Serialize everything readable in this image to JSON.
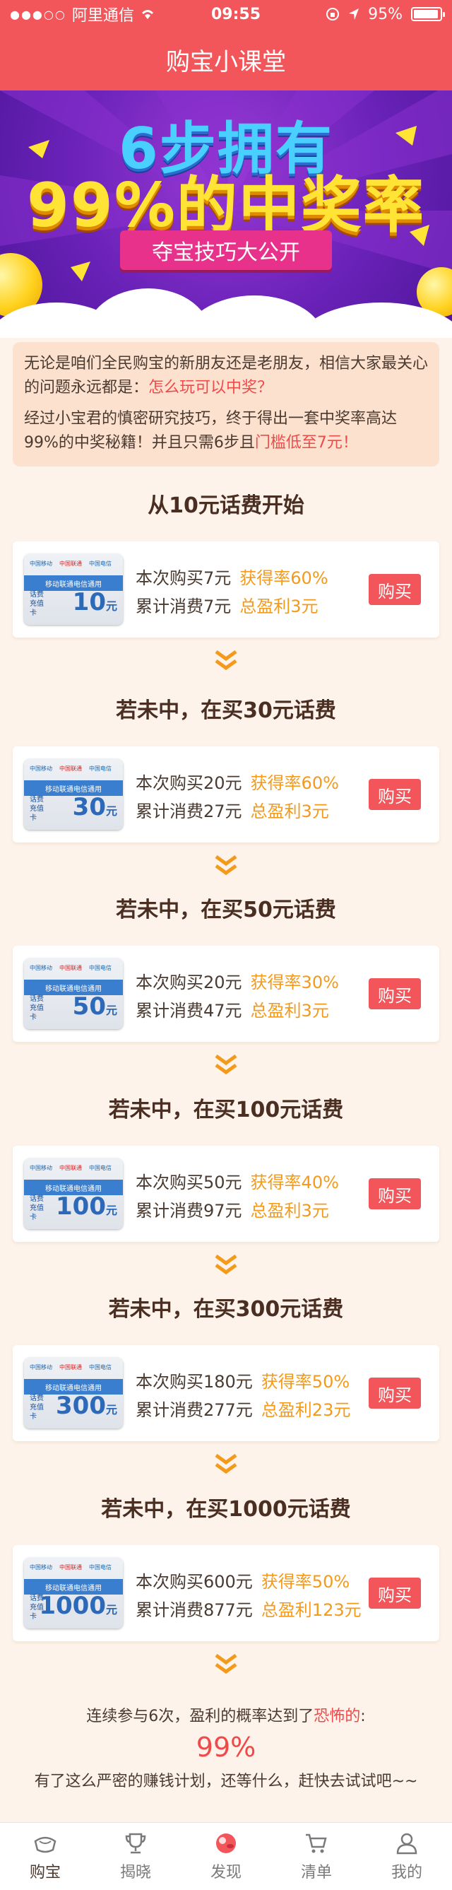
{
  "status": {
    "carrier": "阿里通信",
    "time": "09:55",
    "battery": "95%",
    "battery_level": 0.95
  },
  "nav": {
    "title": "购宝小课堂"
  },
  "banner": {
    "title_line1": "6步拥有",
    "title_line2": "99%的中奖率",
    "ribbon": "夺宝技巧大公开"
  },
  "intro": {
    "p1_text": "无论是咱们全民购宝的新朋友还是老朋友，相信大家最关心的问题永远都是：",
    "p1_highlight": "怎么玩可以中奖？",
    "p2_text": "经过小宝君的慎密研究技巧，终于得出一套中奖率高达99%的中奖秘籍！并且只需6步且",
    "p2_highlight": "门槛低至7元！"
  },
  "card_face": {
    "logo1": "中国移动",
    "logo2": "中国联通",
    "logo3": "中国电信",
    "band": "移动联通电信通用",
    "label": "话费充值卡",
    "unit": "元"
  },
  "steps": [
    {
      "title": "从10元话费开始",
      "amount": "10",
      "buy_line": "本次购买7元",
      "rate": "获得率60%",
      "total_line": "累计消费7元",
      "profit": "总盈利3元",
      "button": "购买"
    },
    {
      "title": "若未中，在买30元话费",
      "amount": "30",
      "buy_line": "本次购买20元",
      "rate": "获得率60%",
      "total_line": "累计消费27元",
      "profit": "总盈利3元",
      "button": "购买"
    },
    {
      "title": "若未中，在买50元话费",
      "amount": "50",
      "buy_line": "本次购买20元",
      "rate": "获得率30%",
      "total_line": "累计消费47元",
      "profit": "总盈利3元",
      "button": "购买"
    },
    {
      "title": "若未中，在买100元话费",
      "amount": "100",
      "buy_line": "本次购买50元",
      "rate": "获得率40%",
      "total_line": "累计消费97元",
      "profit": "总盈利3元",
      "button": "购买"
    },
    {
      "title": "若未中，在买300元话费",
      "amount": "300",
      "buy_line": "本次购买180元",
      "rate": "获得率50%",
      "total_line": "累计消费277元",
      "profit": "总盈利23元",
      "button": "购买"
    },
    {
      "title": "若未中，在买1000元话费",
      "amount": "1000",
      "buy_line": "本次购买600元",
      "rate": "获得率50%",
      "total_line": "累计消费877元",
      "profit": "总盈利123元",
      "button": "购买"
    }
  ],
  "summary": {
    "line1_text": "连续参与6次，盈利的概率达到了",
    "line1_highlight": "恐怖的",
    "line1_end": ":",
    "percent": "99%",
    "line3": "有了这么严密的赚钱计划，还等什么，赶快去试试吧~~"
  },
  "tabs": [
    {
      "label": "购宝",
      "icon": "bowl-icon"
    },
    {
      "label": "揭晓",
      "icon": "trophy-icon"
    },
    {
      "label": "发现",
      "icon": "discover-ball-icon"
    },
    {
      "label": "清单",
      "icon": "cart-icon"
    },
    {
      "label": "我的",
      "icon": "user-icon"
    }
  ],
  "colors": {
    "header": "#f2555a",
    "accent_orange": "#f39a1b",
    "highlight_red": "#ef4a4a",
    "page_bg": "#fdf3ea"
  }
}
